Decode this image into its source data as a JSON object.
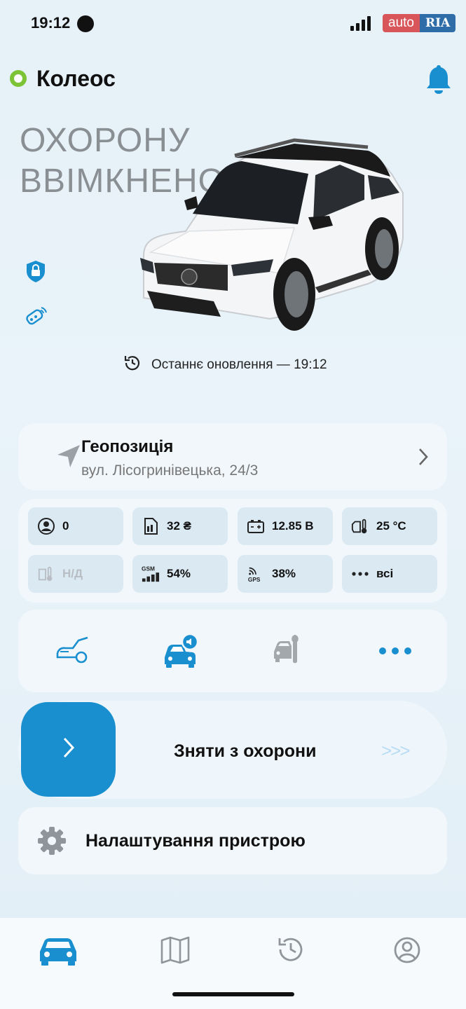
{
  "status_bar": {
    "time": "19:12",
    "watermark_auto": "auto",
    "watermark_ria": "RIA"
  },
  "header": {
    "car_name": "Колеос",
    "online_color": "#7cc436",
    "accent_color": "#1a8fd0"
  },
  "security": {
    "title_line1": "ОХОРОНУ",
    "title_line2": "ВВІМКНЕНО"
  },
  "last_update": {
    "label": "Останнє оновлення — 19:12"
  },
  "geo": {
    "title": "Геопозиція",
    "address": "вул. Лісогринівецька, 24/3"
  },
  "tiles": [
    {
      "icon": "user-circle-icon",
      "value": "0"
    },
    {
      "icon": "sim-card-icon",
      "value": "32 ₴"
    },
    {
      "icon": "battery-icon",
      "value": "12.85 В"
    },
    {
      "icon": "engine-temperature-icon",
      "value": "25 °C"
    },
    {
      "icon": "fuel-temperature-icon",
      "value": "Н/Д"
    },
    {
      "icon": "gsm-signal-icon",
      "value": "54%"
    },
    {
      "icon": "gps-signal-icon",
      "value": "38%"
    },
    {
      "icon": "more-dots-icon",
      "value": "всі"
    }
  ],
  "signal_levels": {
    "gsm_percent": 54,
    "gps_percent": 38
  },
  "actions": [
    "trunk-icon",
    "car-alarm-sound-icon",
    "car-service-icon",
    "more-icon"
  ],
  "disarm": {
    "label": "Зняти з охорони",
    "hint": ">>>"
  },
  "settings": {
    "label": "Налаштування пристрою"
  },
  "nav": [
    "car-tab-icon",
    "map-tab-icon",
    "history-tab-icon",
    "profile-tab-icon"
  ]
}
